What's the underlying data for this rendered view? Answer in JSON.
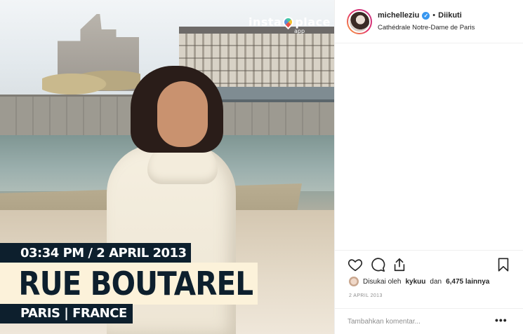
{
  "photo": {
    "logo_text": "insta place",
    "logo_sub": "app",
    "caption_datetime": "03:34 PM / 2 APRIL 2013",
    "caption_title": "RUE BOUTAREL",
    "caption_place": "PARIS | FRANCE"
  },
  "header": {
    "username": "michelleziu",
    "verified": "✓",
    "separator": "•",
    "follow_status": "Diikuti",
    "location": "Cathédrale Notre-Dame de Paris"
  },
  "actions": {
    "like_icon": "heart-icon",
    "comment_icon": "comment-icon",
    "share_icon": "share-icon",
    "save_icon": "bookmark-icon"
  },
  "likes": {
    "prefix": "Disukai oleh",
    "user": "kykuu",
    "middle": "dan",
    "count": "6,475 lainnya"
  },
  "post_date": "2 APRIL 2013",
  "comment": {
    "placeholder": "Tambahkan komentar...",
    "more_label": "•••"
  }
}
